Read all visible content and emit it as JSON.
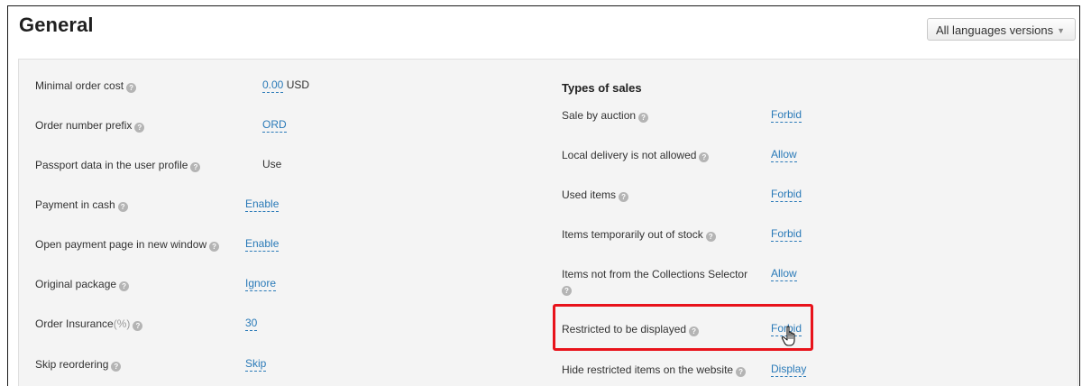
{
  "header": {
    "title": "General",
    "languages_button": "All languages versions"
  },
  "left_settings": [
    {
      "label": "Minimal order cost",
      "value": "0.00",
      "unit": "USD",
      "link": true
    },
    {
      "label": "Order number prefix",
      "value": "ORD",
      "link": true
    },
    {
      "label": "Passport data in the user profile",
      "value": "Use",
      "link": false
    },
    {
      "label": "Payment in cash",
      "value": "Enable",
      "link": true
    },
    {
      "label": "Open payment page in new window",
      "value": "Enable",
      "link": true
    },
    {
      "label": "Original package",
      "value": "Ignore",
      "link": true
    },
    {
      "label": "Order Insurance",
      "label_suffix": "(%)",
      "value": "30",
      "link": true
    },
    {
      "label": "Skip reordering",
      "value": "Skip",
      "link": true
    }
  ],
  "types_of_sales": {
    "title": "Types of sales",
    "items": [
      {
        "label": "Sale by auction",
        "value": "Forbid"
      },
      {
        "label": "Local delivery is not allowed",
        "value": "Allow"
      },
      {
        "label": "Used items",
        "value": "Forbid"
      },
      {
        "label": "Items temporarily out of stock",
        "value": "Forbid"
      },
      {
        "label": "Items not from the Collections Selector",
        "value": "Allow"
      },
      {
        "label": "Restricted to be displayed",
        "value": "Forbid"
      },
      {
        "label": "Hide restricted items on the website",
        "value": "Display"
      }
    ]
  },
  "icons": {
    "help": "?",
    "caret": "▼"
  },
  "colors": {
    "link": "#2a7ab8",
    "highlight": "#e8131b",
    "panel_bg": "#f4f4f4"
  }
}
